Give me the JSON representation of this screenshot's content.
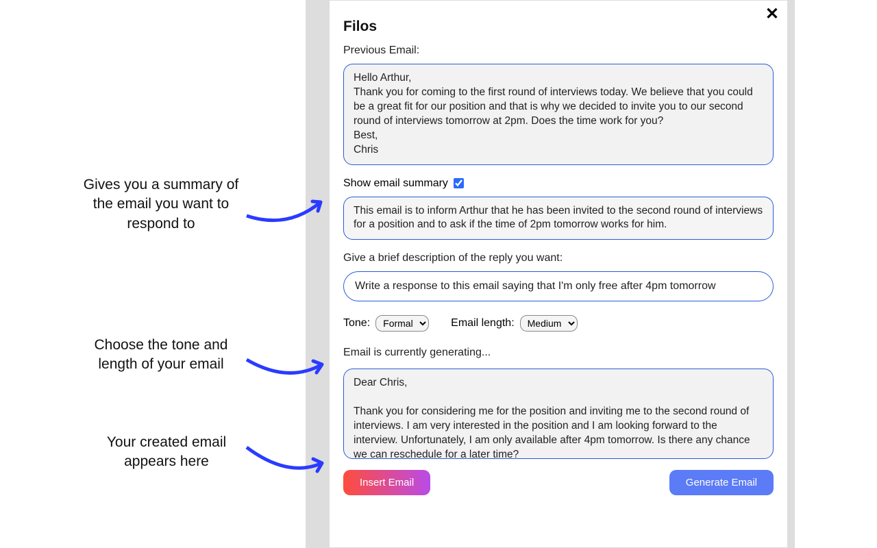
{
  "modal": {
    "title": "Filos",
    "prev_label": "Previous Email:",
    "prev_email": "Hello Arthur,\nThank you for coming to the first round of interviews today. We believe that you could be a great fit for our position and that is why we decided to invite you to our second round of interviews tomorrow at 2pm. Does the time work for you?\nBest,\nChris",
    "summary_label": "Show email summary",
    "summary_checked": true,
    "summary_text": "This email is to inform Arthur that he has been invited to the second round of interviews for a position and to ask if the time of 2pm tomorrow works for him.",
    "desc_label": "Give a brief description of the reply you want:",
    "desc_value": "Write a response to this email saying that I'm only free after 4pm tomorrow",
    "tone_label": "Tone:",
    "tone_value": "Formal",
    "length_label": "Email length:",
    "length_value": "Medium",
    "status": "Email is currently generating...",
    "output": "Dear Chris,\n\nThank you for considering me for the position and inviting me to the second round of interviews. I am very interested in the position and I am looking forward to the interview. Unfortunately, I am only available after 4pm tomorrow. Is there any chance we can reschedule for a later time?",
    "insert_btn": "Insert Email",
    "generate_btn": "Generate Email"
  },
  "annotations": {
    "a1": "Gives you a summary of the email you want to respond to",
    "a2": "Choose the tone and length of your email",
    "a3": "Your created email appears here"
  }
}
